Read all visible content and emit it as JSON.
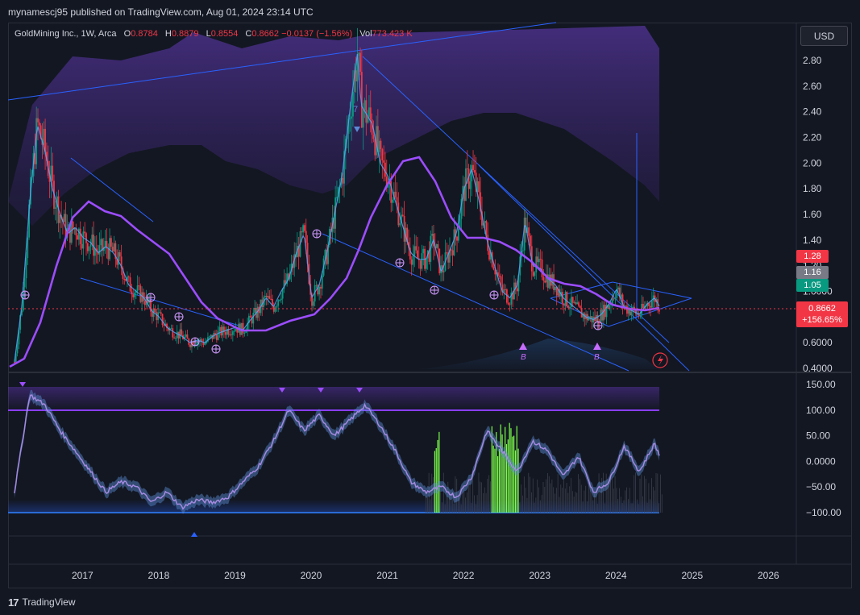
{
  "header": {
    "published": "mynamescj95 published on TradingView.com, Aug 01, 2024 23:14 UTC"
  },
  "legend": {
    "symbol": "GoldMining Inc., 1W, Arca",
    "o_label": "O",
    "o": "0.8784",
    "h_label": "H",
    "h": "0.8879",
    "l_label": "L",
    "l": "0.8554",
    "c_label": "C",
    "c": "0.8662",
    "change": "−0.0137 (−1.56%)",
    "vol_label": "Vol",
    "vol": "773.423 K"
  },
  "currency_button": "USD",
  "price_tags": [
    {
      "label": "1.28",
      "color": "#f23645"
    },
    {
      "label": "1.16",
      "color": "#787b86"
    },
    {
      "label": "1.05",
      "color": "#089981"
    }
  ],
  "last_price": {
    "price": "0.8662",
    "change": "+156.65%",
    "color": "#f23645"
  },
  "footer": {
    "brand": "TradingView",
    "logo_text": "17"
  },
  "markers": {
    "seven_label": "7",
    "b_label": "B"
  },
  "colors": {
    "background": "#131722",
    "bull": "#089981",
    "bear": "#f23645",
    "ma": "#9c4dff",
    "trendline": "#2962ff",
    "cloud": "#4a2c8a",
    "osc_up": "#5aa7ff",
    "osc_down": "#9c6ad6",
    "volume_spike": "#7cff4a"
  },
  "chart_data": [
    {
      "type": "line",
      "title": "GoldMining Inc., 1W, Arca",
      "y_ticks": [
        "2.80",
        "2.60",
        "2.40",
        "2.20",
        "2.00",
        "1.80",
        "1.60",
        "1.40",
        "1.20",
        "1.0000",
        "0.8000",
        "0.6000",
        "0.4000"
      ],
      "x_ticks": [
        "2017",
        "2018",
        "2019",
        "2020",
        "2021",
        "2022",
        "2023",
        "2024",
        "2025",
        "2026"
      ],
      "ylim": [
        0.4,
        2.95
      ],
      "xlim": [
        2016.05,
        2026.95
      ],
      "series": [
        {
          "x": [
            2016.1,
            2016.2,
            2016.3,
            2016.4,
            2016.5,
            2016.6,
            2016.7,
            2016.8,
            2016.9,
            2017.0,
            2017.1,
            2017.2,
            2017.3,
            2017.4,
            2017.5,
            2017.6,
            2017.7,
            2017.8,
            2017.9,
            2018.0,
            2018.1,
            2018.2,
            2018.3,
            2018.4,
            2018.5,
            2018.6,
            2018.7,
            2018.8,
            2018.9,
            2019.0,
            2019.1,
            2019.2,
            2019.3,
            2019.4,
            2019.5,
            2019.6,
            2019.7,
            2019.8,
            2019.9,
            2020.0,
            2020.1,
            2020.2,
            2020.3,
            2020.4,
            2020.5,
            2020.6,
            2020.65,
            2020.7,
            2020.8,
            2020.9,
            2021.0,
            2021.1,
            2021.2,
            2021.3,
            2021.4,
            2021.5,
            2021.6,
            2021.7,
            2021.8,
            2021.9,
            2022.0,
            2022.1,
            2022.2,
            2022.3,
            2022.4,
            2022.5,
            2022.6,
            2022.7,
            2022.8,
            2022.9,
            2023.0,
            2023.1,
            2023.2,
            2023.3,
            2023.4,
            2023.5,
            2023.6,
            2023.7,
            2023.8,
            2023.9,
            2024.0,
            2024.1,
            2024.2,
            2024.3,
            2024.4,
            2024.5,
            2024.58
          ],
          "values": [
            0.45,
            0.9,
            1.7,
            2.3,
            2.1,
            1.8,
            1.6,
            1.45,
            1.5,
            1.42,
            1.38,
            1.3,
            1.35,
            1.3,
            1.2,
            1.05,
            1.0,
            0.95,
            0.85,
            0.8,
            0.72,
            0.68,
            0.65,
            0.6,
            0.62,
            0.6,
            0.65,
            0.68,
            0.7,
            0.72,
            0.7,
            0.78,
            0.85,
            0.95,
            0.88,
            1.0,
            1.1,
            1.3,
            1.45,
            0.95,
            1.05,
            1.3,
            1.6,
            1.9,
            2.4,
            2.85,
            2.45,
            2.4,
            2.3,
            2.0,
            1.9,
            1.7,
            1.5,
            1.3,
            1.25,
            1.25,
            1.4,
            1.15,
            1.3,
            1.45,
            1.8,
            1.95,
            1.7,
            1.4,
            1.2,
            1.0,
            0.95,
            1.05,
            1.55,
            1.2,
            1.18,
            1.1,
            1.05,
            0.95,
            0.9,
            0.85,
            0.8,
            0.78,
            0.82,
            0.9,
            1.02,
            0.88,
            0.85,
            0.82,
            0.9,
            0.95,
            0.8662
          ]
        }
      ]
    },
    {
      "type": "line",
      "y_ticks": [
        "150.00",
        "100.00",
        "50.00",
        "0.0000",
        "−50.00",
        "−100.00"
      ],
      "ylim": [
        -120,
        150
      ],
      "series": [
        {
          "x": [
            2016.1,
            2016.3,
            2016.5,
            2016.7,
            2016.9,
            2017.1,
            2017.3,
            2017.5,
            2017.7,
            2017.9,
            2018.1,
            2018.3,
            2018.5,
            2018.7,
            2018.9,
            2019.1,
            2019.3,
            2019.5,
            2019.7,
            2019.9,
            2020.1,
            2020.3,
            2020.5,
            2020.7,
            2020.9,
            2021.1,
            2021.3,
            2021.5,
            2021.7,
            2021.9,
            2022.1,
            2022.3,
            2022.5,
            2022.7,
            2022.9,
            2023.1,
            2023.3,
            2023.5,
            2023.7,
            2023.9,
            2024.1,
            2024.3,
            2024.5,
            2024.58
          ],
          "values": [
            -60,
            130,
            110,
            60,
            20,
            -20,
            -60,
            -40,
            -50,
            -80,
            -60,
            -90,
            -75,
            -80,
            -70,
            -40,
            -10,
            40,
            100,
            60,
            90,
            50,
            80,
            110,
            70,
            20,
            -40,
            -60,
            -50,
            -70,
            -30,
            60,
            20,
            -20,
            40,
            20,
            -30,
            10,
            -60,
            -40,
            30,
            -20,
            35,
            5
          ]
        }
      ]
    }
  ]
}
